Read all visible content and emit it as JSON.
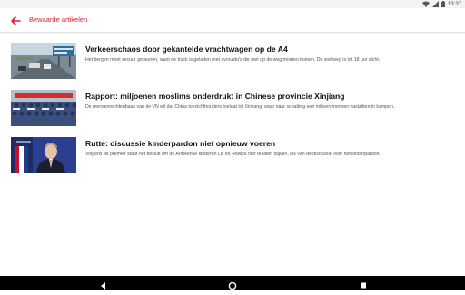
{
  "status_bar": {
    "time": "13:37"
  },
  "toolbar": {
    "title": "Bewaarde artikelen",
    "accent": "#d8242f"
  },
  "articles": [
    {
      "headline": "Verkeerschaos door gekantelde vrachtwagen op de A4",
      "summary": "Het bergen moet secuur gebeuren, want de truck is geladen met avocado's die niet op de weg moeten komen. De snelweg is tot 18 uur dicht."
    },
    {
      "headline": "Rapport: miljoenen moslims onderdrukt in Chinese provincie Xinjiang",
      "summary": "De mensenrechtenbaas van de VN wil dat China toezichthouders toelaat tot Xinjiang, waar naar schatting een miljoen mensen vastzitten in kampen."
    },
    {
      "headline": "Rutte: discussie kinderpardon niet opnieuw voeren",
      "summary": "Volgens de premier staat het besluit om de Armeense kinderen Lili en Howick hier te laten blijven, los van de discussie over het kinderpardon."
    }
  ]
}
